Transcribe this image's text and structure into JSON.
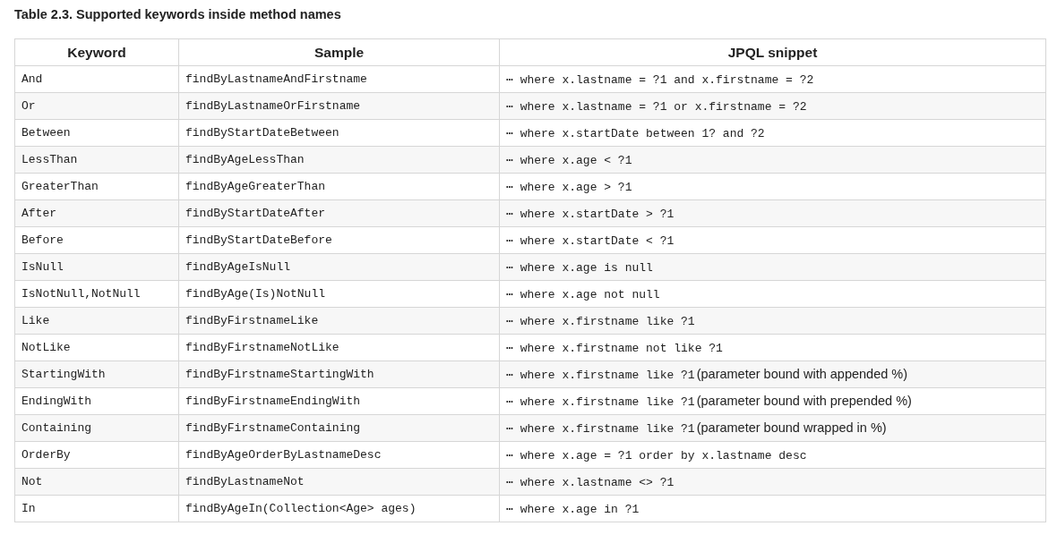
{
  "table": {
    "title": "Table 2.3. Supported keywords inside method names",
    "columns": [
      "Keyword",
      "Sample",
      "JPQL snippet"
    ],
    "rows": [
      {
        "keyword": "And",
        "sample": "findByLastnameAndFirstname",
        "snippet": "⋯ where x.lastname = ?1 and x.firstname = ?2"
      },
      {
        "keyword": "Or",
        "sample": "findByLastnameOrFirstname",
        "snippet": "⋯ where x.lastname = ?1 or x.firstname = ?2"
      },
      {
        "keyword": "Between",
        "sample": "findByStartDateBetween",
        "snippet": "⋯ where x.startDate between 1? and ?2"
      },
      {
        "keyword": "LessThan",
        "sample": "findByAgeLessThan",
        "snippet": "⋯ where x.age < ?1"
      },
      {
        "keyword": "GreaterThan",
        "sample": "findByAgeGreaterThan",
        "snippet": "⋯ where x.age > ?1"
      },
      {
        "keyword": "After",
        "sample": "findByStartDateAfter",
        "snippet": "⋯ where x.startDate > ?1"
      },
      {
        "keyword": "Before",
        "sample": "findByStartDateBefore",
        "snippet": "⋯ where x.startDate < ?1"
      },
      {
        "keyword": "IsNull",
        "sample": "findByAgeIsNull",
        "snippet": "⋯ where x.age is null"
      },
      {
        "keyword": "IsNotNull,NotNull",
        "sample": "findByAge(Is)NotNull",
        "snippet": "⋯ where x.age not null"
      },
      {
        "keyword": "Like",
        "sample": "findByFirstnameLike",
        "snippet": "⋯ where x.firstname like ?1"
      },
      {
        "keyword": "NotLike",
        "sample": "findByFirstnameNotLike",
        "snippet": "⋯ where x.firstname not like ?1"
      },
      {
        "keyword": "StartingWith",
        "sample": "findByFirstnameStartingWith",
        "snippet": "⋯ where x.firstname like ?1",
        "note": "(parameter bound with appended %)"
      },
      {
        "keyword": "EndingWith",
        "sample": "findByFirstnameEndingWith",
        "snippet": "⋯ where x.firstname like ?1",
        "note": "(parameter bound with prepended %)"
      },
      {
        "keyword": "Containing",
        "sample": "findByFirstnameContaining",
        "snippet": "⋯ where x.firstname like ?1",
        "note": "(parameter bound wrapped in %)"
      },
      {
        "keyword": "OrderBy",
        "sample": "findByAgeOrderByLastnameDesc",
        "snippet": "⋯ where x.age = ?1 order by x.lastname desc"
      },
      {
        "keyword": "Not",
        "sample": "findByLastnameNot",
        "snippet": "⋯ where x.lastname <> ?1"
      },
      {
        "keyword": "In",
        "sample": "findByAgeIn(Collection<Age> ages)",
        "snippet": "⋯ where x.age in ?1"
      }
    ]
  }
}
